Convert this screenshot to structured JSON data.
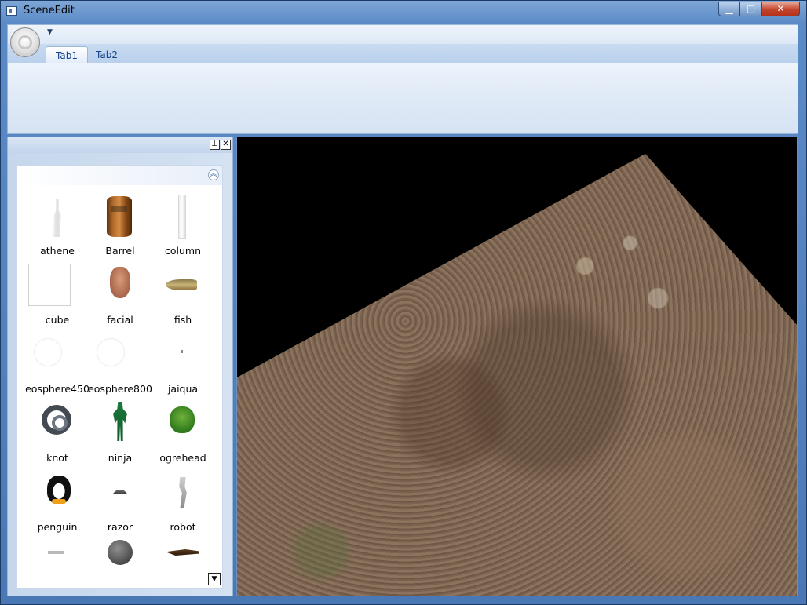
{
  "window": {
    "title": "SceneEdit"
  },
  "ribbon": {
    "tabs": [
      "Tab1",
      "Tab2"
    ]
  },
  "panel": {
    "items": [
      {
        "label": "athene"
      },
      {
        "label": "Barrel"
      },
      {
        "label": "column"
      },
      {
        "label": "cube"
      },
      {
        "label": "facial"
      },
      {
        "label": "fish"
      },
      {
        "label": "eosphere450"
      },
      {
        "label": "eosphere800"
      },
      {
        "label": "jaiqua"
      },
      {
        "label": "knot"
      },
      {
        "label": "ninja"
      },
      {
        "label": "ogrehead"
      },
      {
        "label": "penguin"
      },
      {
        "label": "razor"
      },
      {
        "label": "robot"
      }
    ]
  }
}
